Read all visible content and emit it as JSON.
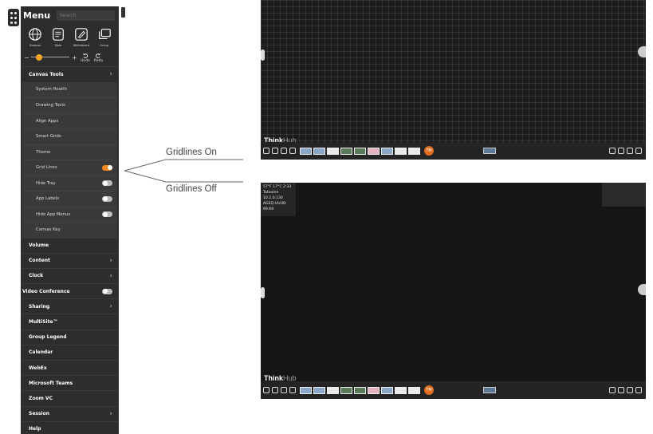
{
  "menu": {
    "title": "Menu",
    "search_placeholder": "Search",
    "quick_actions": [
      {
        "label": "Browser",
        "icon": "globe-icon"
      },
      {
        "label": "Note",
        "icon": "note-icon"
      },
      {
        "label": "Whiteboard",
        "icon": "whiteboard-icon"
      },
      {
        "label": "Group",
        "icon": "group-icon"
      }
    ],
    "slider": {
      "minus": "−",
      "plus": "+",
      "value": 0.15
    },
    "undo_label": "Undo",
    "redo_label": "Redo",
    "canvas_tools": {
      "label": "Canvas Tools",
      "items": [
        {
          "label": "System Health"
        },
        {
          "label": "Drawing Tools"
        },
        {
          "label": "Align Apps"
        },
        {
          "label": "Smart Grids"
        },
        {
          "label": "Theme"
        },
        {
          "label": "Grid Lines",
          "toggle": true,
          "on": true
        },
        {
          "label": "Hide Tray",
          "toggle": true,
          "on": false
        },
        {
          "label": "App Labels",
          "toggle": true,
          "on": false
        },
        {
          "label": "Hide App Menus",
          "toggle": true,
          "on": false
        },
        {
          "label": "Canvas Key"
        }
      ]
    },
    "items": [
      {
        "label": "Volume",
        "chevron": false
      },
      {
        "label": "Content",
        "chevron": true
      },
      {
        "label": "Clock",
        "chevron": true
      },
      {
        "label": "Video Conference",
        "toggle": true,
        "on": false
      },
      {
        "label": "Sharing",
        "chevron": true
      },
      {
        "label": "MultiSite™",
        "chevron": false
      },
      {
        "label": "Group Legend",
        "chevron": false
      },
      {
        "label": "Calendar",
        "chevron": false
      },
      {
        "label": "WebEx",
        "chevron": false
      },
      {
        "label": "Microsoft Teams",
        "chevron": false
      },
      {
        "label": "Zoom VC",
        "chevron": false
      },
      {
        "label": "Session",
        "chevron": true
      },
      {
        "label": "Help",
        "chevron": false
      }
    ]
  },
  "callouts": {
    "on": "Gridlines On",
    "off": "Gridlines Off"
  },
  "screens": {
    "brand_bold": "Think",
    "brand_light": "Hub",
    "avatar": "TM",
    "status_header": "57°F  17°C  2:33",
    "status_lines": [
      "Tatooine",
      "10.2.0.130",
      "AGEQ-UUUD",
      "69.69"
    ]
  },
  "colors": {
    "accent": "#f08a1f",
    "panel": "#2d2d2d",
    "subpanel": "#3a3a3a"
  }
}
